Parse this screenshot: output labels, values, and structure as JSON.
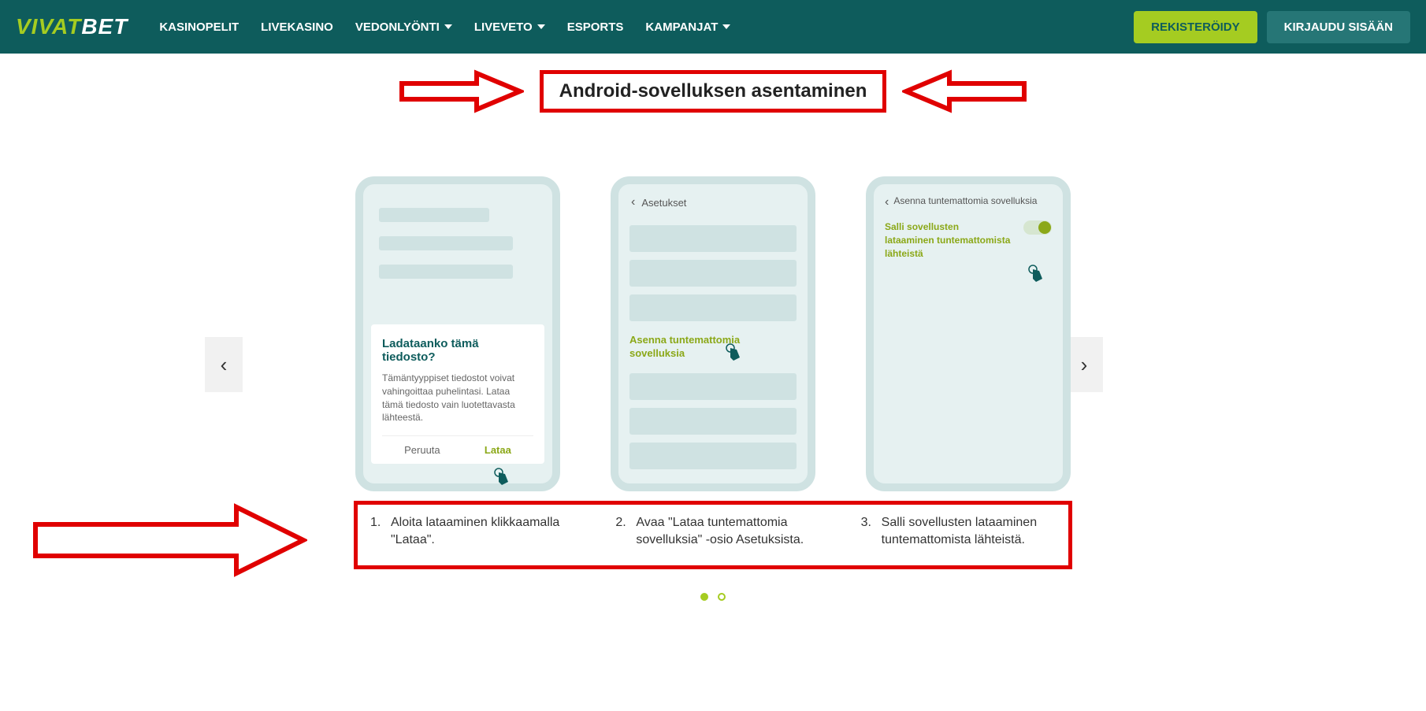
{
  "header": {
    "logo1": "VIVAT",
    "logo2": "BET",
    "nav": [
      "KASINOPELIT",
      "LIVEKASINO",
      "VEDONLYÖNTI",
      "LIVEVETO",
      "ESPORTS",
      "KAMPANJAT"
    ],
    "register": "REKISTERÖIDY",
    "login": "KIRJAUDU SISÄÄN"
  },
  "title": "Android-sovelluksen asentaminen",
  "phone1": {
    "dialog_title": "Ladataanko tämä tiedosto?",
    "dialog_body": "Tämäntyyppiset tiedostot voivat vahingoittaa puhelintasi. Lataa tämä tiedosto vain luotettavasta lähteestä.",
    "cancel": "Peruuta",
    "download": "Lataa"
  },
  "phone2": {
    "head": "Asetukset",
    "link": "Asenna tuntemattomia sovelluksia"
  },
  "phone3": {
    "head": "Asenna tuntemattomia sovelluksia",
    "text": "Salli sovellusten lataaminen tuntemattomista lähteistä"
  },
  "captions": [
    {
      "num": "1.",
      "text": "Aloita lataaminen klikkaamalla \"Lataa\"."
    },
    {
      "num": "2.",
      "text": "Avaa \"Lataa tuntemattomia sovelluksia\" -osio Asetuksista."
    },
    {
      "num": "3.",
      "text": "Salli sovellusten lataaminen tuntemattomista lähteistä."
    }
  ]
}
